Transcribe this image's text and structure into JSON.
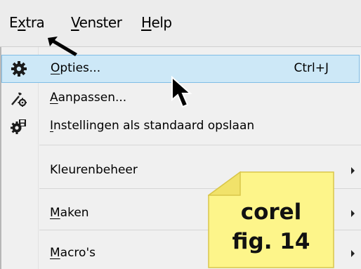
{
  "menubar": {
    "items": [
      {
        "pre": "E",
        "u": "x",
        "post": "tra"
      },
      {
        "pre": "",
        "u": "V",
        "post": "enster"
      },
      {
        "pre": "",
        "u": "H",
        "post": "elp"
      }
    ]
  },
  "menu": {
    "items": [
      {
        "u": "O",
        "post": "pties...",
        "shortcut": "Ctrl+J",
        "icon": "gear-icon"
      },
      {
        "u": "A",
        "post": "anpassen...",
        "icon": "customize-tools-icon"
      },
      {
        "u": "I",
        "post": "nstellingen als standaard opslaan",
        "icon": "save-settings-gear-icon"
      },
      {
        "u": "",
        "post": "Kleurenbeheer"
      },
      {
        "u": "M",
        "post": "aken"
      },
      {
        "u": "M",
        "post": "acro's"
      }
    ]
  },
  "note": {
    "line1": "corel",
    "line2": "fig. 14",
    "color": "#fdf58a",
    "border_color": "#d9c64a"
  },
  "colors": {
    "highlight": "#cde8f7",
    "highlight_border": "#7fbde6",
    "menubar_bg": "#ececec",
    "menu_bg": "#f0f0f0"
  }
}
